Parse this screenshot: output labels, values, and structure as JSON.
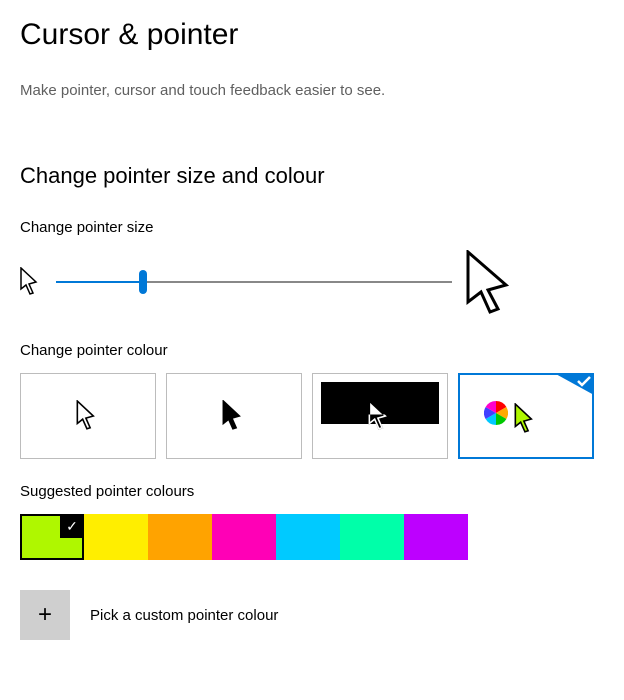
{
  "title": "Cursor & pointer",
  "subtitle": "Make pointer, cursor and touch feedback easier to see.",
  "section": {
    "heading": "Change pointer size and colour",
    "size": {
      "label": "Change pointer size",
      "value": 22,
      "min": 0,
      "max": 100
    },
    "colour": {
      "label": "Change pointer colour",
      "schemes": [
        "white",
        "black",
        "inverted",
        "custom"
      ],
      "selected_scheme": "custom"
    },
    "suggested": {
      "label": "Suggested pointer colours",
      "selected_index": 0,
      "colours": [
        "#aff700",
        "#ffee00",
        "#ffa300",
        "#ff00b6",
        "#00caff",
        "#00ffa9",
        "#bd00ff"
      ]
    },
    "custom": {
      "label": "Pick a custom pointer colour",
      "icon": "plus"
    }
  }
}
